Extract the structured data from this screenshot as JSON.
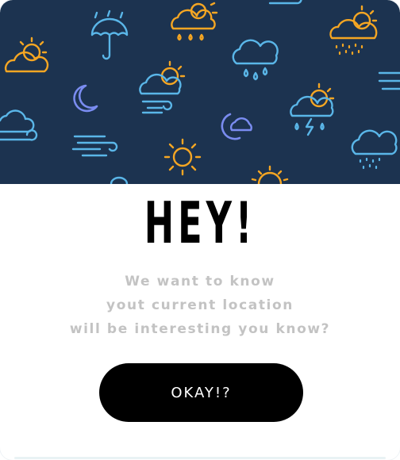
{
  "dialog": {
    "title": "HEY!",
    "message_lines": [
      "We want to know",
      "yout current location",
      "will be interesting you know?"
    ],
    "confirm_label": "OKAY!?"
  },
  "theme": {
    "banner_bg": "#1c3350",
    "sun_color": "#f5a623",
    "cloud_color": "#5ab6e8",
    "moon_color": "#7a8cf0",
    "button_bg": "#000000",
    "message_color": "#c3c3c3"
  },
  "banner_icons": [
    "sun-cloud-icon",
    "rain-cloud-icon",
    "umbrella-icon",
    "sun-cloud-rain-icon",
    "wind-icon",
    "sun-cloud-icon",
    "moon-icon",
    "sun-cloud-wind-icon",
    "rain-cloud-icon",
    "sun-cloud-snow-icon",
    "cloud-icon",
    "wind-icon",
    "sun-icon",
    "moon-cloud-icon",
    "sun-cloud-storm-icon",
    "snow-cloud-icon",
    "sun-icon"
  ]
}
